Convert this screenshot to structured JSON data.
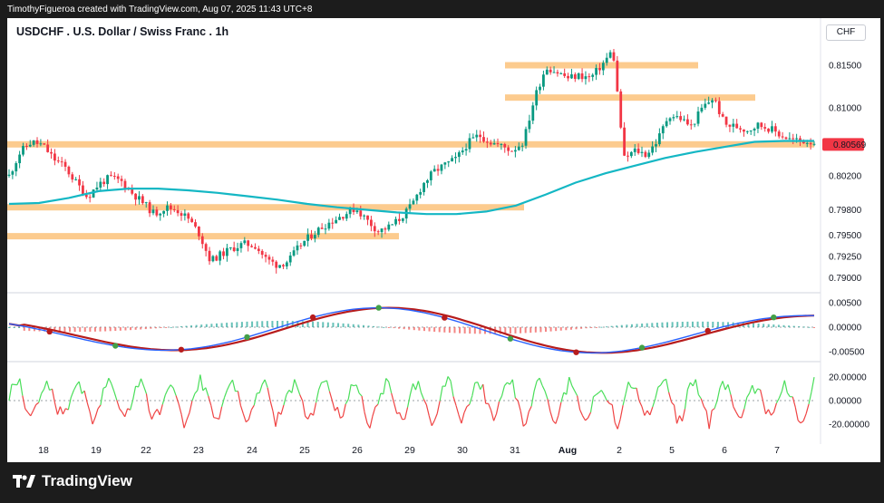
{
  "header": {
    "attribution": "TimothyFigueroa created with TradingView.com, Aug 07, 2025 11:43 UTC+8",
    "title": "USDCHF . U.S. Dollar / Swiss Franc . 1h",
    "currency": "CHF"
  },
  "footer": {
    "logo_text": "TradingView"
  },
  "colors": {
    "up": "#089981",
    "down": "#f23645",
    "ma": "#14b7c4",
    "zone": "#fbc27a",
    "price_tag": "#f23645",
    "macd_fast": "#2962ff",
    "macd_slow_down": "#b71c1c",
    "macd_slow_up": "#43a047",
    "osc_up": "#4ade5a",
    "osc_down": "#ef4444"
  },
  "chart_data": [
    {
      "type": "candlestick",
      "title": "USDCHF . U.S. Dollar / Swiss Franc . 1h",
      "yaxis": {
        "ticks": [
          "0.81500",
          "0.81000",
          "0.80200",
          "0.79800",
          "0.79500",
          "0.79250",
          "0.79000"
        ],
        "ylim": [
          0.7888,
          0.8195
        ]
      },
      "xaxis": {
        "ticks": [
          "18",
          "19",
          "22",
          "23",
          "24",
          "25",
          "26",
          "29",
          "30",
          "31",
          "Aug",
          "2",
          "5",
          "6",
          "7"
        ]
      },
      "last_price": "0.80569",
      "price_path": [
        0.802,
        0.8048,
        0.806,
        0.8056,
        0.804,
        0.803,
        0.8012,
        0.7995,
        0.801,
        0.8018,
        0.8014,
        0.8,
        0.7988,
        0.7975,
        0.7983,
        0.798,
        0.797,
        0.7952,
        0.792,
        0.7928,
        0.7935,
        0.794,
        0.7938,
        0.7922,
        0.7915,
        0.792,
        0.7938,
        0.795,
        0.796,
        0.7968,
        0.7975,
        0.7982,
        0.7968,
        0.7955,
        0.796,
        0.797,
        0.7985,
        0.801,
        0.8025,
        0.8033,
        0.804,
        0.8058,
        0.8068,
        0.806,
        0.8055,
        0.805,
        0.806,
        0.8112,
        0.8148,
        0.8142,
        0.8135,
        0.8138,
        0.8135,
        0.815,
        0.8168,
        0.804,
        0.805,
        0.8045,
        0.8062,
        0.8092,
        0.8088,
        0.8078,
        0.81,
        0.8112,
        0.808,
        0.8078,
        0.8074,
        0.808,
        0.8076,
        0.8068,
        0.8062,
        0.8061,
        0.806
      ],
      "moving_average": [
        0.7987,
        0.7988,
        0.7994,
        0.8002,
        0.8005,
        0.8005,
        0.8003,
        0.8,
        0.7996,
        0.7992,
        0.7987,
        0.7983,
        0.798,
        0.7977,
        0.7975,
        0.7975,
        0.7978,
        0.7985,
        0.7998,
        0.8012,
        0.8023,
        0.8032,
        0.8041,
        0.8048,
        0.8054,
        0.806,
        0.8061,
        0.8061
      ],
      "zones": [
        {
          "y": 0.815,
          "x_start": "31",
          "x_end": "5"
        },
        {
          "y": 0.8112,
          "x_start": "31",
          "x_end": "6"
        },
        {
          "y": 0.8057,
          "x_start": "18",
          "x_end": "7"
        },
        {
          "y": 0.7983,
          "x_start": "18",
          "x_end": "31"
        },
        {
          "y": 0.7949,
          "x_start": "18",
          "x_end": "29"
        }
      ]
    },
    {
      "type": "macd",
      "yaxis": {
        "ticks": [
          "0.00500",
          "0.00000",
          "-0.00500"
        ],
        "ylim": [
          -0.0066,
          0.0062
        ]
      }
    },
    {
      "type": "oscillator",
      "yaxis": {
        "ticks": [
          "20.00000",
          "0.00000",
          "-20.00000"
        ],
        "ylim": [
          -27,
          27
        ]
      }
    }
  ]
}
